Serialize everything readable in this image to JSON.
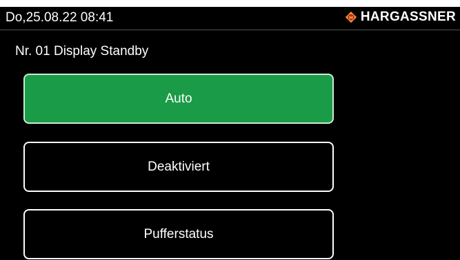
{
  "header": {
    "datetime": "Do,25.08.22 08:41",
    "brand": "HARGASSNER",
    "brand_icon": "hargassner-logo-icon"
  },
  "page": {
    "title": "Nr. 01 Display Standby"
  },
  "options": [
    {
      "label": "Auto",
      "selected": true
    },
    {
      "label": "Deaktiviert",
      "selected": false
    },
    {
      "label": "Pufferstatus",
      "selected": false
    }
  ],
  "colors": {
    "selected_bg": "#1a9b47",
    "screen_bg": "#000000",
    "logo_orange": "#f0a020",
    "logo_red": "#c0202a"
  }
}
